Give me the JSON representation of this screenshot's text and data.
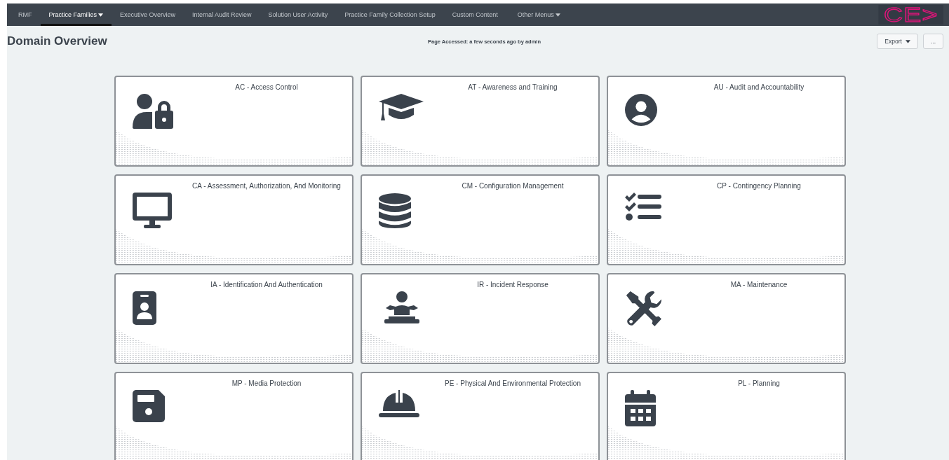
{
  "nav": {
    "items": [
      {
        "label": "RMF",
        "selected": false,
        "has_menu": false
      },
      {
        "label": "Practice Families",
        "selected": true,
        "has_menu": true
      },
      {
        "label": "Executive Overview",
        "selected": false,
        "has_menu": false
      },
      {
        "label": "Internal Audit Review",
        "selected": false,
        "has_menu": false
      },
      {
        "label": "Solution User Activity",
        "selected": false,
        "has_menu": false
      },
      {
        "label": "Practice Family Collection Setup",
        "selected": false,
        "has_menu": false
      },
      {
        "label": "Custom Content",
        "selected": false,
        "has_menu": false
      },
      {
        "label": "Other Menus",
        "selected": false,
        "has_menu": true
      }
    ],
    "logo": "CE>"
  },
  "header": {
    "title": "Domain Overview",
    "access_note": "Page Accessed: a few seconds ago by admin",
    "export_button": "Export",
    "more_button": "..."
  },
  "domains": [
    {
      "title": "AC - Access Control",
      "kind": "user-lock"
    },
    {
      "title": "AT - Awareness and Training",
      "kind": "graduation-cap"
    },
    {
      "title": "AU - Audit and Accountability",
      "kind": "user-circle"
    },
    {
      "title": "CA - Assessment, Authorization, And Monitoring",
      "kind": "monitor"
    },
    {
      "title": "CM - Configuration Management",
      "kind": "database"
    },
    {
      "title": "CP - Contingency Planning",
      "kind": "checklist"
    },
    {
      "title": "IA - Identification And Authentication",
      "kind": "id-badge"
    },
    {
      "title": "IR - Incident Response",
      "kind": "person-desk"
    },
    {
      "title": "MA - Maintenance",
      "kind": "tools"
    },
    {
      "title": "MP - Media Protection",
      "kind": "floppy"
    },
    {
      "title": "PE - Physical And Environmental Protection",
      "kind": "hard-hat"
    },
    {
      "title": "PL - Planning",
      "kind": "calendar"
    }
  ]
}
